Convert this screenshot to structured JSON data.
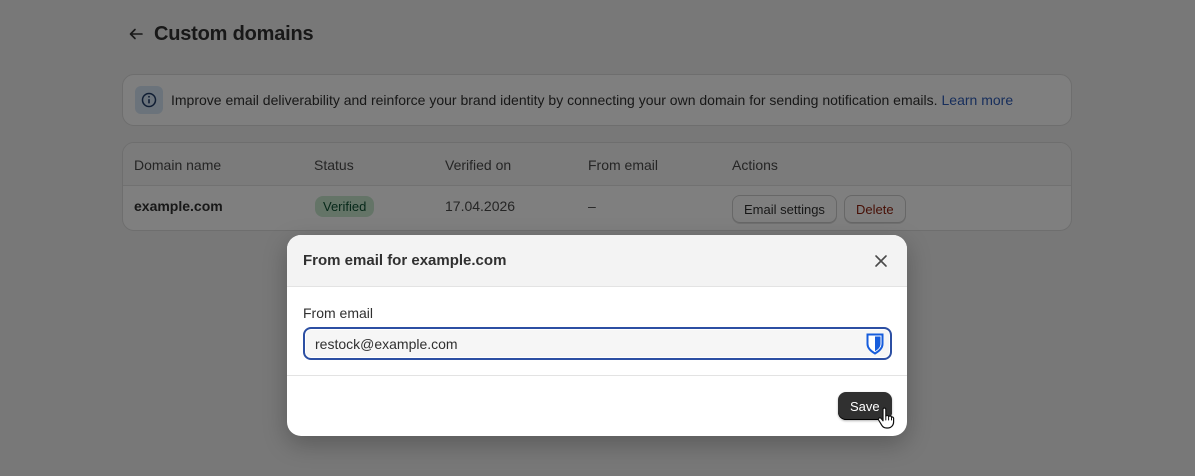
{
  "header": {
    "title": "Custom domains",
    "back_icon": "arrow-left-icon"
  },
  "banner": {
    "text": "Improve email deliverability and reinforce your brand identity by connecting your own domain for sending notification emails.",
    "link": "Learn more",
    "icon": "info-icon"
  },
  "table": {
    "columns": [
      "Domain name",
      "Status",
      "Verified on",
      "From email",
      "Actions"
    ],
    "rows": [
      {
        "domain": "example.com",
        "status": "Verified",
        "verified_on": "17.04.2026",
        "from_email": "–",
        "actions": [
          "Email settings",
          "Delete"
        ]
      }
    ]
  },
  "modal": {
    "title": "From email for example.com",
    "field_label": "From email",
    "field_value": "restock@example.com",
    "save_label": "Save"
  },
  "colors": {
    "accent": "#2c4fa3",
    "link": "#2f5db8",
    "badge_bg": "#c9e9cf",
    "danger": "#8e1f0b",
    "primary_button": "#303030"
  }
}
